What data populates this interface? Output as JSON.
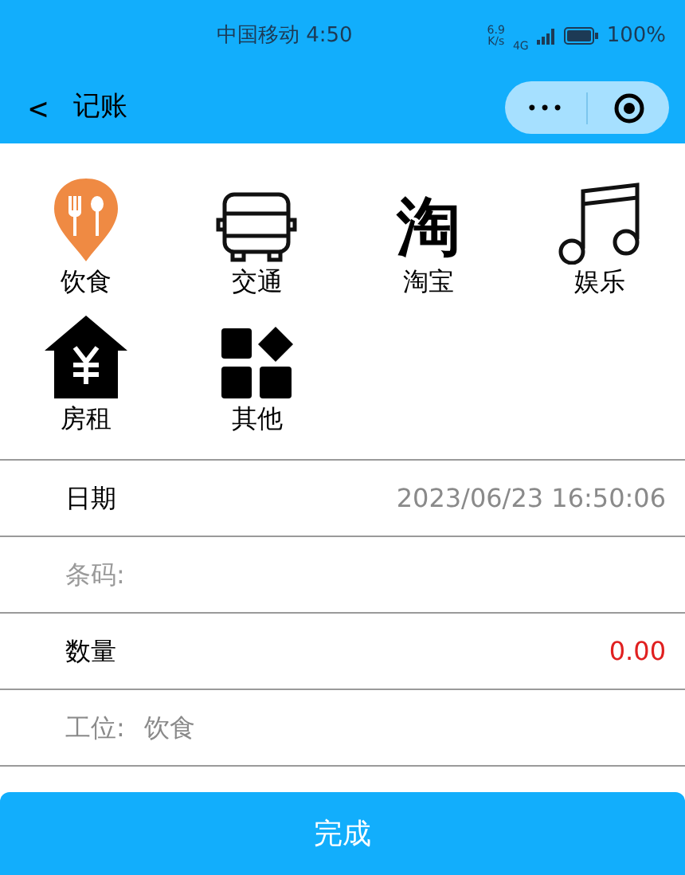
{
  "status_bar": {
    "carrier_time": "中国移动 4:50",
    "speed": "6.9",
    "speed_unit": "K/s",
    "network": "4G",
    "battery": "100%"
  },
  "nav": {
    "back": "<",
    "title": "记账",
    "more": "•••"
  },
  "categories": [
    {
      "kind": "food",
      "label": "饮食"
    },
    {
      "kind": "bus",
      "label": "交通"
    },
    {
      "kind": "glyph",
      "glyph": "淘",
      "label": "淘宝"
    },
    {
      "kind": "music",
      "label": "娱乐"
    },
    {
      "kind": "rent",
      "label": "房租"
    },
    {
      "kind": "other",
      "label": "其他"
    }
  ],
  "form": [
    {
      "kind": "date",
      "label": "日期",
      "value": "2023/06/23 16:50:06"
    },
    {
      "kind": "input",
      "placeholder": "条码:"
    },
    {
      "kind": "amount",
      "label": "数量",
      "value": "0.00"
    },
    {
      "kind": "info",
      "label": "工位:",
      "value": "饮食"
    }
  ],
  "submit": "完成"
}
